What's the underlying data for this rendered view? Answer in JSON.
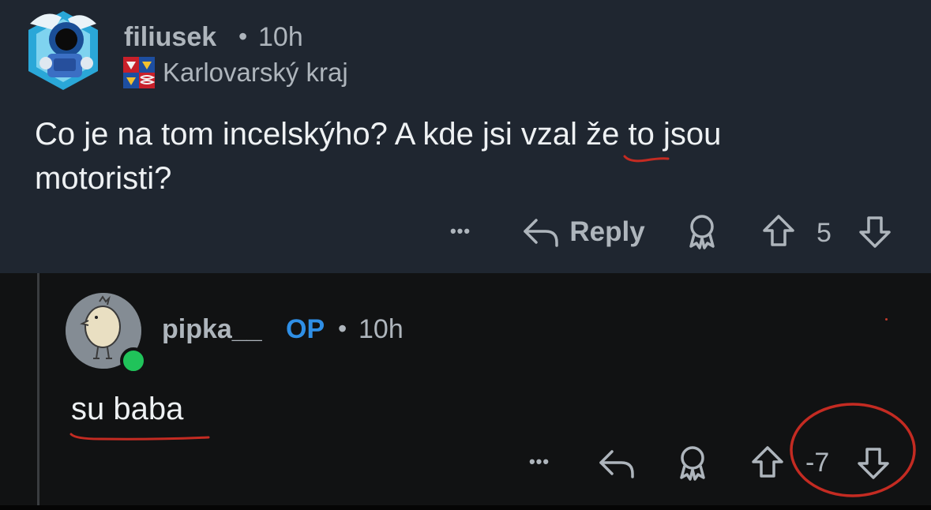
{
  "comment1": {
    "username": "filiusek",
    "separator": "•",
    "time": "10h",
    "flair": "Karlovarský kraj",
    "flair_icon": "czech-region-flag-icon",
    "body_line1": "Co je na tom incelskýho? A kde jsi vzal že to jsou",
    "body_line2": "motoristi?",
    "actions": {
      "more": "•••",
      "reply": "Reply",
      "score": "5"
    }
  },
  "comment2": {
    "username": "pipka__",
    "op_label": "OP",
    "separator": "•",
    "time": "10h",
    "body": "su baba",
    "actions": {
      "more": "•••",
      "score": "-7"
    },
    "online_status": "online"
  },
  "colors": {
    "top_background": "#1f2630",
    "bottom_background": "#111213",
    "op_blue": "#2f8fe6",
    "online_green": "#20c35a",
    "annotation_red": "#c42b22"
  }
}
